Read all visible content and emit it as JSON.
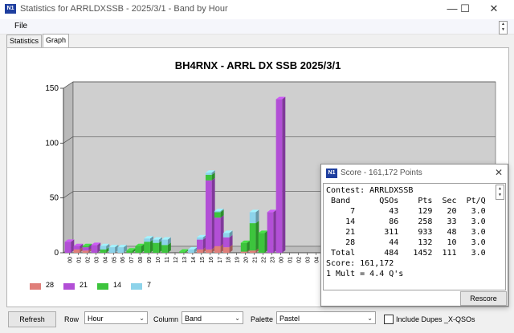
{
  "window": {
    "title": "Statistics for ARRLDXSSB - 2025/3/1 - Band by Hour",
    "icon_label": "N1",
    "minimize": "—",
    "maximize": "☐",
    "close": "✕"
  },
  "menu": {
    "file": "File"
  },
  "tabs": [
    {
      "label": "Statistics"
    },
    {
      "label": "Graph"
    }
  ],
  "colors": {
    "b28": "#e07f7a",
    "b21": "#b24fd6",
    "b14": "#3dc43d",
    "b7": "#8dd3ea",
    "plot_bg": "#cfcfcf"
  },
  "chart_data": {
    "type": "bar",
    "stacked": true,
    "title": "BH4RNX - ARRL DX SSB 2025/3/1",
    "ylim": [
      0,
      150
    ],
    "yticks": [
      "150",
      "100",
      "50",
      "0"
    ],
    "categories": [
      "00",
      "01",
      "02",
      "03",
      "04",
      "05",
      "06",
      "07",
      "08",
      "09",
      "10",
      "11",
      "12",
      "13",
      "14",
      "15",
      "16",
      "17",
      "18",
      "19",
      "20",
      "21",
      "22",
      "23",
      "00",
      "01",
      "02",
      "03",
      "04",
      "05",
      "06",
      "07",
      "08",
      "09",
      "10",
      "11",
      "12",
      "13",
      "14",
      "15",
      "16",
      "17",
      "18",
      "19",
      "20",
      "21",
      "22",
      "23"
    ],
    "series": [
      {
        "name": "28",
        "color": "#e07f7a",
        "values": [
          0,
          3,
          2,
          0,
          0,
          0,
          0,
          0,
          0,
          0,
          0,
          0,
          0,
          0,
          0,
          3,
          3,
          6,
          5,
          0,
          1,
          2,
          0,
          0,
          0,
          0,
          0,
          0,
          0,
          0,
          0,
          0,
          0,
          0,
          0,
          0,
          0,
          0,
          0,
          0,
          0,
          0,
          0,
          0,
          0,
          0,
          0,
          0
        ]
      },
      {
        "name": "21",
        "color": "#b24fd6",
        "values": [
          10,
          3,
          3,
          7,
          0,
          0,
          0,
          0,
          0,
          0,
          0,
          0,
          0,
          0,
          0,
          9,
          63,
          26,
          9,
          0,
          0,
          0,
          0,
          37,
          140,
          0,
          0,
          0,
          0,
          0,
          0,
          0,
          0,
          0,
          0,
          0,
          0,
          0,
          0,
          0,
          0,
          0,
          0,
          0,
          0,
          0,
          0,
          0
        ]
      },
      {
        "name": "14",
        "color": "#3dc43d",
        "values": [
          0,
          0,
          1,
          0,
          3,
          0,
          0,
          2,
          6,
          10,
          9,
          7,
          0,
          1,
          0,
          0,
          5,
          5,
          0,
          0,
          8,
          25,
          18,
          0,
          0,
          0,
          0,
          0,
          0,
          0,
          0,
          0,
          0,
          0,
          0,
          0,
          0,
          0,
          0,
          0,
          0,
          0,
          0,
          0,
          0,
          0,
          0,
          0
        ]
      },
      {
        "name": "7",
        "color": "#8dd3ea",
        "values": [
          0,
          0,
          0,
          0,
          3,
          5,
          5,
          0,
          0,
          3,
          3,
          5,
          0,
          0,
          3,
          2,
          2,
          1,
          4,
          0,
          0,
          10,
          0,
          0,
          0,
          0,
          0,
          0,
          0,
          0,
          0,
          0,
          0,
          0,
          0,
          0,
          0,
          0,
          0,
          0,
          0,
          0,
          0,
          0,
          0,
          0,
          0,
          0
        ]
      }
    ],
    "legend": "bottom-left",
    "grid": true
  },
  "toolbar": {
    "refresh": "Refresh",
    "row_label": "Row",
    "row_value": "Hour",
    "column_label": "Column",
    "column_value": "Band",
    "palette_label": "Palette",
    "palette_value": "Pastel",
    "dupes_label": "Include Dupes _X-QSOs",
    "dupes_checked": false
  },
  "score": {
    "title": "Score - 161,172 Points",
    "contest": "Contest: ARRLDXSSB",
    "header": {
      "band": "Band",
      "qsos": "QSOs",
      "pts": "Pts",
      "sec": "Sec",
      "ptq": "Pt/Q"
    },
    "rows": [
      {
        "band": "7",
        "qsos": "43",
        "pts": "129",
        "sec": "20",
        "ptq": "3.0"
      },
      {
        "band": "14",
        "qsos": "86",
        "pts": "258",
        "sec": "33",
        "ptq": "3.0"
      },
      {
        "band": "21",
        "qsos": "311",
        "pts": "933",
        "sec": "48",
        "ptq": "3.0"
      },
      {
        "band": "28",
        "qsos": "44",
        "pts": "132",
        "sec": "10",
        "ptq": "3.0"
      },
      {
        "band": "Total",
        "qsos": "484",
        "pts": "1452",
        "sec": "111",
        "ptq": "3.0"
      }
    ],
    "score_line": "Score: 161,172",
    "mult_line": "1 Mult = 4.4 Q's",
    "rescore": "Rescore"
  }
}
